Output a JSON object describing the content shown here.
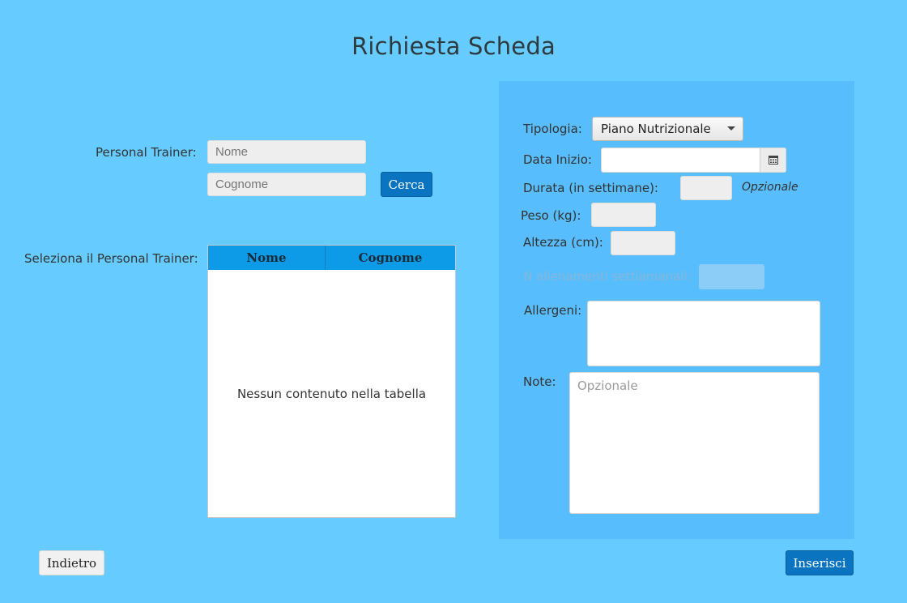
{
  "title": "Richiesta Scheda",
  "left": {
    "personal_trainer_label": "Personal Trainer:",
    "nome_placeholder": "Nome",
    "cognome_placeholder": "Cognome",
    "search_button": "Cerca",
    "select_label": "Seleziona il Personal Trainer:",
    "table": {
      "columns": [
        "Nome",
        "Cognome"
      ],
      "rows": [],
      "empty_message": "Nessun contenuto nella tabella"
    }
  },
  "form": {
    "tipologia_label": "Tipologia:",
    "tipologia_value": "Piano Nutrizionale",
    "data_inizio_label": "Data Inizio:",
    "data_inizio_value": "",
    "durata_label": "Durata (in settimane):",
    "durata_hint": "Opzionale",
    "peso_label": "Peso (kg):",
    "altezza_label": "Altezza (cm):",
    "allenamenti_label": "N allenamenti settiamanali:",
    "allergeni_label": "Allergeni:",
    "note_label": "Note:",
    "note_placeholder": "Opzionale"
  },
  "footer": {
    "back_button": "Indietro",
    "submit_button": "Inserisci"
  },
  "icons": {
    "calendar": "calendar-icon",
    "dropdown": "chevron-down-icon"
  },
  "colors": {
    "background": "#66ccff",
    "panel": "#58bdfc",
    "primary_button": "#0a74c0",
    "table_header": "#0d9be8"
  }
}
